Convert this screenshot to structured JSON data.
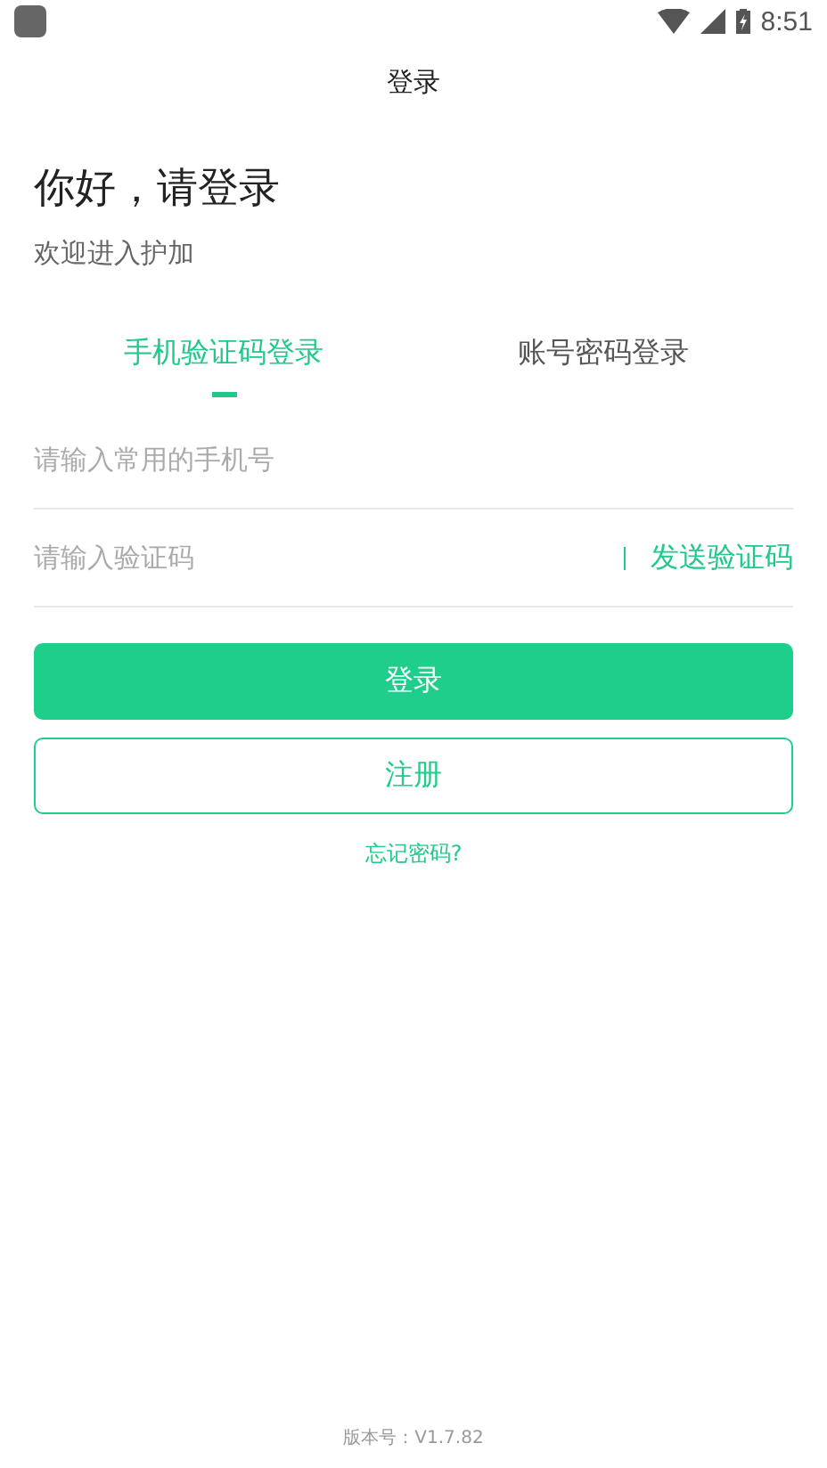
{
  "status_bar": {
    "time": "8:51"
  },
  "header": {
    "title": "登录"
  },
  "greeting": {
    "title": "你好，请登录",
    "subtitle": "欢迎进入护加"
  },
  "tabs": [
    {
      "label": "手机验证码登录",
      "selected": true
    },
    {
      "label": "账号密码登录",
      "selected": false
    }
  ],
  "phone_field": {
    "placeholder": "请输入常用的手机号"
  },
  "code_field": {
    "placeholder": "请输入验证码",
    "send_code": "发送验证码"
  },
  "buttons": {
    "login": "登录",
    "register": "注册"
  },
  "forgot_password": "忘记密码?",
  "version": "版本号：V1.7.82"
}
